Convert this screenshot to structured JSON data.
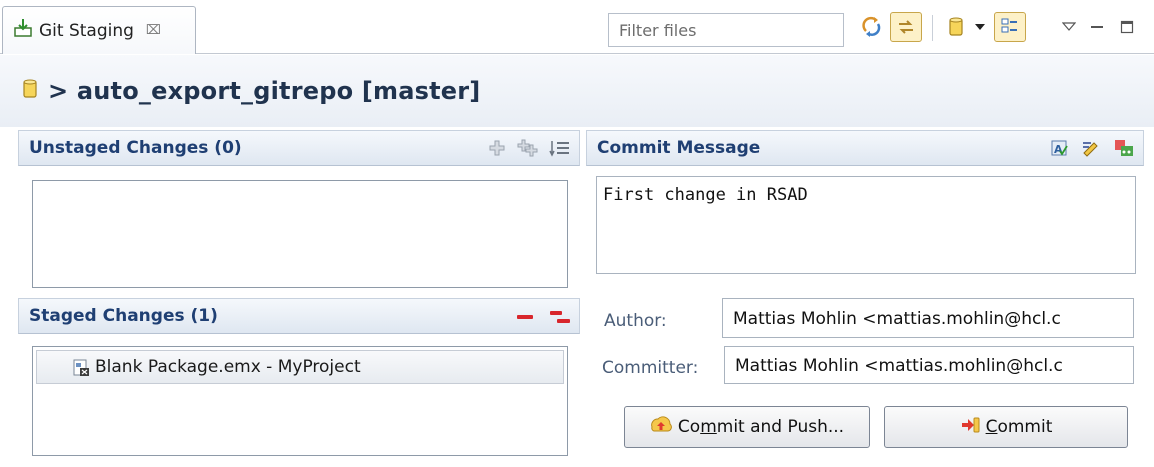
{
  "view_tab": {
    "title": "Git Staging",
    "close_glyph": "⌧"
  },
  "toolbar": {
    "filter_placeholder": "Filter files",
    "icons": [
      "refresh-icon",
      "link-with-selection-icon",
      "repository-icon",
      "dropdown-arrow-icon",
      "presentation-layout-icon",
      "view-menu-icon",
      "minimize-icon",
      "maximize-icon"
    ]
  },
  "repo": {
    "header": "> auto_export_gitrepo [master]"
  },
  "unstaged": {
    "title": "Unstaged Changes (0)",
    "items": []
  },
  "staged": {
    "title": "Staged Changes (1)",
    "items": [
      {
        "label": "Blank Package.emx - MyProject"
      }
    ]
  },
  "commit": {
    "title": "Commit Message",
    "message": "First change in RSAD",
    "author_label": "Author:",
    "author_value": "Mattias Mohlin <mattias.mohlin@hcl.c",
    "committer_label": "Committer:",
    "committer_value": "Mattias Mohlin <mattias.mohlin@hcl.c",
    "push_pre": "Co",
    "push_mnemonic": "m",
    "push_post": "mit and Push...",
    "commit_mnemonic": "C",
    "commit_post": "ommit"
  },
  "colors": {
    "section_title": "#1f3f73",
    "repo_title": "#20334e",
    "header_bg": "#e9eef5"
  }
}
